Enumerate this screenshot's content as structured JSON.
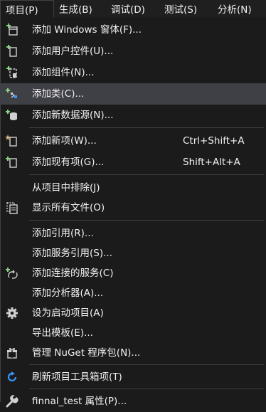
{
  "menubar": {
    "items": [
      {
        "label": "项目(P)",
        "active": true
      },
      {
        "label": "生成(B)"
      },
      {
        "label": "调试(D)"
      },
      {
        "label": "测试(S)"
      },
      {
        "label": "分析(N)"
      }
    ]
  },
  "menu": {
    "add_windows_form": {
      "label": "添加 Windows 窗体(F)...",
      "icon": "add-form-icon"
    },
    "add_user_control": {
      "label": "添加用户控件(U)...",
      "icon": "add-user-control-icon"
    },
    "add_component": {
      "label": "添加组件(N)...",
      "icon": "add-component-icon"
    },
    "add_class": {
      "label": "添加类(C)...",
      "icon": "add-class-icon"
    },
    "add_data_source": {
      "label": "添加新数据源(N)...",
      "icon": "add-data-source-icon"
    },
    "add_new_item": {
      "label": "添加新项(W)...",
      "shortcut": "Ctrl+Shift+A",
      "icon": "add-new-item-icon"
    },
    "add_existing_item": {
      "label": "添加现有项(G)...",
      "shortcut": "Shift+Alt+A",
      "icon": "add-existing-item-icon"
    },
    "exclude_from_project": {
      "label": "从项目中排除(J)"
    },
    "show_all_files": {
      "label": "显示所有文件(O)",
      "icon": "show-all-files-icon"
    },
    "add_reference": {
      "label": "添加引用(R)..."
    },
    "add_service_reference": {
      "label": "添加服务引用(S)..."
    },
    "add_connected_service": {
      "label": "添加连接的服务(C)",
      "icon": "connected-service-icon"
    },
    "add_analyzer": {
      "label": "添加分析器(A)..."
    },
    "set_as_startup": {
      "label": "设为启动项目(A)",
      "icon": "gear-icon"
    },
    "export_template": {
      "label": "导出模板(E)..."
    },
    "manage_nuget": {
      "label": "管理 NuGet 程序包(N)...",
      "icon": "nuget-package-icon"
    },
    "refresh_toolbox": {
      "label": "刷新项目工具箱项(T)",
      "icon": "refresh-icon"
    },
    "properties": {
      "label": "finnal_test 属性(P)...",
      "icon": "wrench-icon"
    }
  },
  "colors": {
    "background": "#1b1b1c",
    "hover": "#3f3f46",
    "text": "#f1f1f1",
    "accent_green": "#89d185",
    "accent_blue": "#3794ff"
  }
}
